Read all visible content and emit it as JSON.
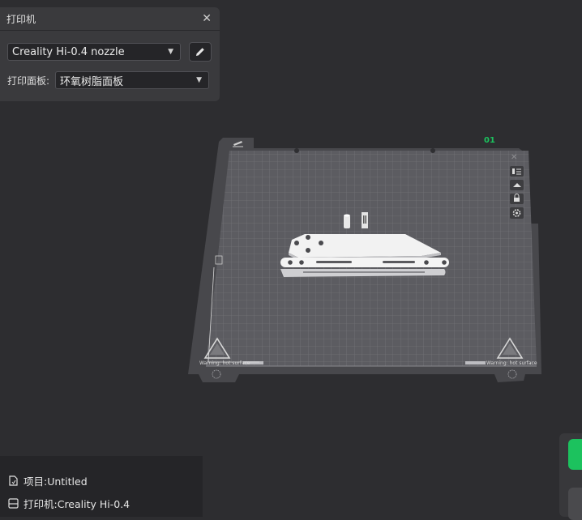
{
  "printer_panel": {
    "title": "打印机",
    "printer_select": "Creality Hi-0.4 nozzle",
    "plate_label": "打印面板:",
    "plate_select": "环氧树脂面板"
  },
  "plate": {
    "number": "01",
    "warning_left": "Warning: hot surface",
    "warning_right": "Warning: hot surface"
  },
  "info": {
    "project": "项目:Untitled",
    "printer": "打印机:Creality Hi-0.4"
  },
  "colors": {
    "accent_green": "#1cc25e",
    "panel_bg": "#3a3a3d",
    "background": "#2d2d30"
  }
}
